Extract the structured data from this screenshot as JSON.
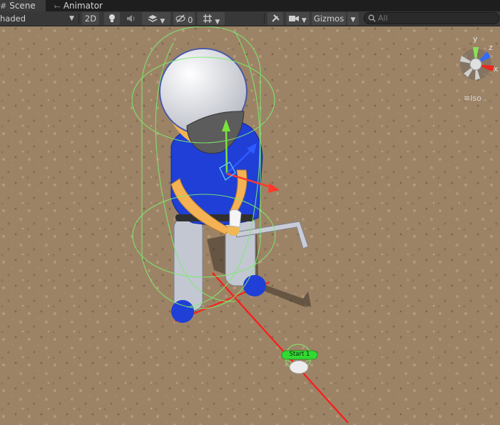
{
  "tabs": [
    {
      "label": "Scene",
      "icon": "#"
    },
    {
      "label": "Animator",
      "icon": "⤚"
    }
  ],
  "toolbar": {
    "draw_mode": "haded",
    "mode_2d": "2D",
    "hidden_count": "0",
    "gizmos": "Gizmos",
    "search_placeholder": "All"
  },
  "scene": {
    "axis_y": "y",
    "axis_z": "z",
    "axis_x": "x",
    "projection": "Iso",
    "marker_label": "Start 1"
  },
  "colors": {
    "ground": "#9d8366",
    "selection_green": "#7CEB6E",
    "shirt_blue": "#1f3fd6",
    "aim_line_red": "#ff1a1a"
  }
}
